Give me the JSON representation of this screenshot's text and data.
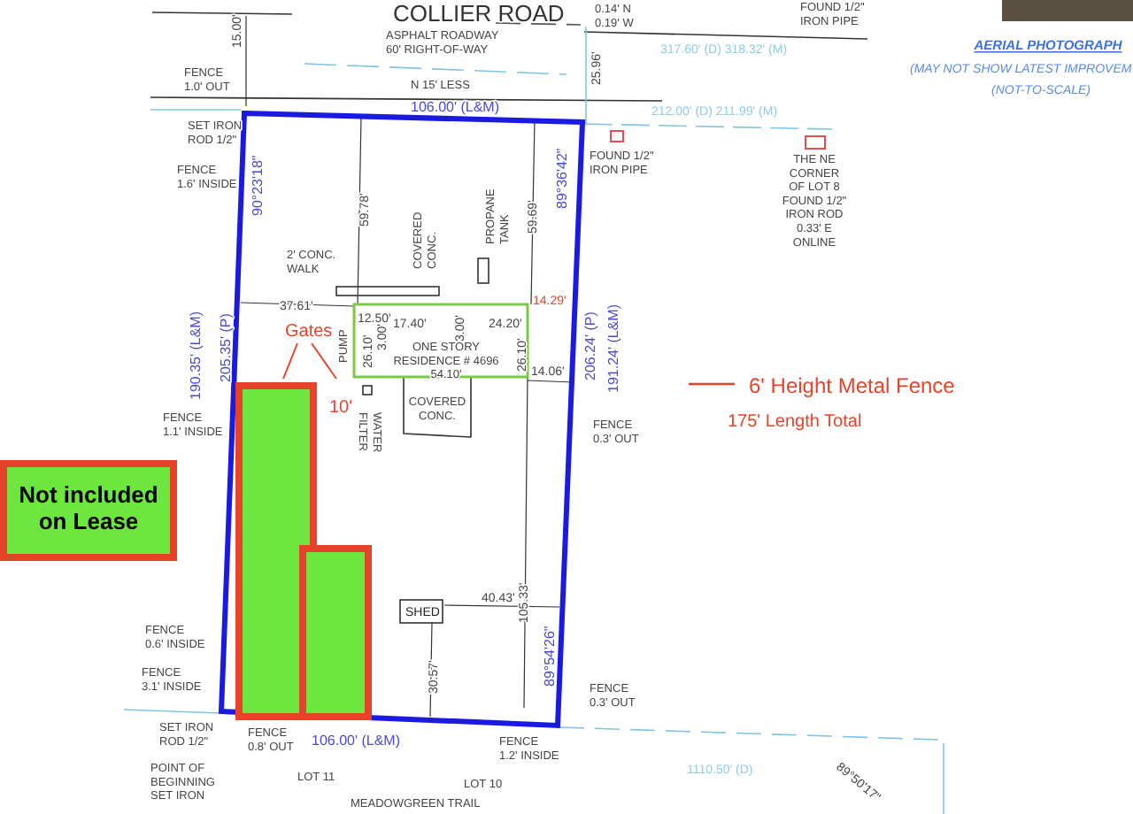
{
  "drawing": {
    "labels": [
      {
        "kind": "road",
        "lines": [
          "COLLIER ROAD"
        ]
      },
      {
        "kind": "note",
        "lines": [
          "ASPHALT ROADWAY",
          "60' RIGHT-OF-WAY"
        ]
      },
      {
        "kind": "dimension",
        "lines": [
          "15.00'"
        ]
      },
      {
        "kind": "note",
        "lines": [
          "FENCE",
          "1.0' OUT"
        ]
      },
      {
        "kind": "note",
        "lines": [
          "N 15' LESS"
        ]
      },
      {
        "kind": "bearing",
        "lines": [
          "106.00' (L&M)"
        ]
      },
      {
        "kind": "note",
        "lines": [
          "SET IRON",
          "ROD 1/2\""
        ]
      },
      {
        "kind": "note",
        "lines": [
          "FENCE",
          "1.6' INSIDE"
        ]
      },
      {
        "kind": "bearing",
        "lines": [
          "90°23'18\""
        ]
      },
      {
        "kind": "dimension",
        "lines": [
          "59.78'"
        ]
      },
      {
        "kind": "note",
        "lines": [
          "COVERED",
          "CONC."
        ]
      },
      {
        "kind": "note",
        "lines": [
          "PROPANE",
          "TANK"
        ]
      },
      {
        "kind": "dimension",
        "lines": [
          "59.69'"
        ]
      },
      {
        "kind": "bearing",
        "lines": [
          "89°36'42\""
        ]
      },
      {
        "kind": "note",
        "lines": [
          "2' CONC.",
          "WALK"
        ]
      },
      {
        "kind": "note",
        "lines": [
          "0.14' N",
          "0.19' W"
        ]
      },
      {
        "kind": "note",
        "lines": [
          "FOUND 1/2\"",
          "IRON PIPE"
        ]
      },
      {
        "kind": "record",
        "lines": [
          "317.60' (D) 318.32' (M)"
        ]
      },
      {
        "kind": "dimension",
        "lines": [
          "25.96'"
        ]
      },
      {
        "kind": "record",
        "lines": [
          "212.00' (D) 211.99' (M)"
        ]
      },
      {
        "kind": "note",
        "lines": [
          "FOUND 1/2\"",
          "IRON PIPE"
        ]
      },
      {
        "kind": "note",
        "lines": [
          "THE NE",
          "CORNER",
          "OF LOT 8",
          "FOUND 1/2\"",
          "IRON ROD",
          "0.33' E",
          "ONLINE"
        ]
      },
      {
        "kind": "photo_title",
        "lines": [
          "AERIAL PHOTOGRAPH"
        ]
      },
      {
        "kind": "photo_note",
        "lines": [
          "(MAY NOT SHOW LATEST IMPROVEM"
        ]
      },
      {
        "kind": "photo_note",
        "lines": [
          "(NOT-TO-SCALE)"
        ]
      },
      {
        "kind": "bearing",
        "lines": [
          "190.35' (L&M)"
        ]
      },
      {
        "kind": "bearing",
        "lines": [
          "205.35' (P)"
        ]
      },
      {
        "kind": "dimension",
        "lines": [
          "37.61'"
        ]
      },
      {
        "kind": "callout_small",
        "lines": [
          "14.29'"
        ]
      },
      {
        "kind": "dimension",
        "lines": [
          "12.50'"
        ]
      },
      {
        "kind": "dimension",
        "lines": [
          "17.40'"
        ]
      },
      {
        "kind": "dimension",
        "lines": [
          "3.00'"
        ]
      },
      {
        "kind": "dimension",
        "lines": [
          "3.00'"
        ]
      },
      {
        "kind": "dimension",
        "lines": [
          "24.20'"
        ]
      },
      {
        "kind": "note",
        "lines": [
          "ONE STORY",
          "RESIDENCE # 4696",
          "54.10'"
        ]
      },
      {
        "kind": "dimension",
        "lines": [
          "26.10'"
        ]
      },
      {
        "kind": "dimension",
        "lines": [
          "26.10'"
        ]
      },
      {
        "kind": "dimension",
        "lines": [
          "14.06'"
        ]
      },
      {
        "kind": "note",
        "lines": [
          "PUMP"
        ]
      },
      {
        "kind": "callout",
        "lines": [
          "Gates"
        ]
      },
      {
        "kind": "callout",
        "lines": [
          "10'"
        ]
      },
      {
        "kind": "note",
        "lines": [
          "WATER",
          "FILTER"
        ]
      },
      {
        "kind": "note",
        "lines": [
          "COVERED",
          "CONC."
        ]
      },
      {
        "kind": "bearing",
        "lines": [
          "206.24' (P)"
        ]
      },
      {
        "kind": "bearing",
        "lines": [
          "191.24' (L&M)"
        ]
      },
      {
        "kind": "legend",
        "lines": [
          "6' Height Metal Fence"
        ]
      },
      {
        "kind": "note",
        "lines": [
          "FENCE",
          "1.1' INSIDE"
        ]
      },
      {
        "kind": "note",
        "lines": [
          "FENCE",
          "0.3' OUT"
        ]
      },
      {
        "kind": "callout",
        "lines": [
          "175' Length Total"
        ]
      },
      {
        "kind": "dimension",
        "lines": [
          "105.33'"
        ]
      },
      {
        "kind": "dimension",
        "lines": [
          "40.43'"
        ]
      },
      {
        "kind": "shed",
        "lines": [
          "SHED"
        ]
      },
      {
        "kind": "dimension",
        "lines": [
          "30.57'"
        ]
      },
      {
        "kind": "bearing",
        "lines": [
          "89°54'26\""
        ]
      },
      {
        "kind": "note",
        "lines": [
          "FENCE",
          "0.6' INSIDE"
        ]
      },
      {
        "kind": "note",
        "lines": [
          "FENCE",
          "3.1' INSIDE"
        ]
      },
      {
        "kind": "note",
        "lines": [
          "SET IRON",
          "ROD 1/2\""
        ]
      },
      {
        "kind": "note",
        "lines": [
          "POINT OF",
          "BEGINNING",
          "SET IRON"
        ]
      },
      {
        "kind": "note",
        "lines": [
          "FENCE",
          "0.8' OUT"
        ]
      },
      {
        "kind": "bearing",
        "lines": [
          "106.00' (L&M)"
        ]
      },
      {
        "kind": "note",
        "lines": [
          "LOT 11"
        ]
      },
      {
        "kind": "note",
        "lines": [
          "MEADOWGREEN TRAIL"
        ]
      },
      {
        "kind": "note",
        "lines": [
          "FENCE",
          "1.2' INSIDE"
        ]
      },
      {
        "kind": "note",
        "lines": [
          "LOT 10"
        ]
      },
      {
        "kind": "note",
        "lines": [
          "FENCE",
          "0.3' OUT"
        ]
      },
      {
        "kind": "record",
        "lines": [
          "1110.50' (D)"
        ]
      },
      {
        "kind": "dimension",
        "lines": [
          "89°50'17\""
        ]
      }
    ]
  },
  "excluded_area": {
    "lines": [
      "Not included",
      "on Lease"
    ]
  }
}
